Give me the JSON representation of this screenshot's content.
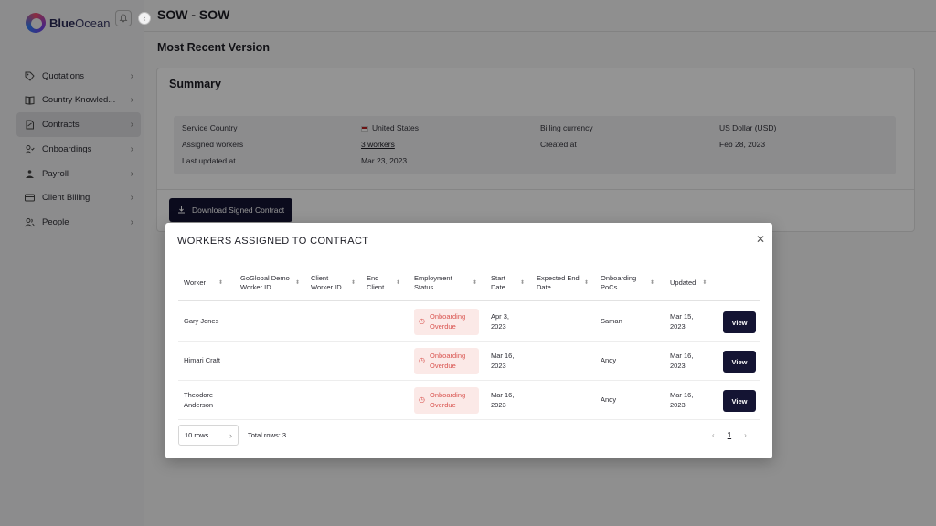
{
  "sidebar": {
    "logo": {
      "bold": "Blue",
      "rest": "Ocean"
    },
    "items": [
      {
        "label": "Quotations",
        "icon": "tag-icon"
      },
      {
        "label": "Country Knowled...",
        "icon": "book-icon"
      },
      {
        "label": "Contracts",
        "icon": "contract-icon",
        "active": true
      },
      {
        "label": "Onboardings",
        "icon": "user-check-icon"
      },
      {
        "label": "Payroll",
        "icon": "payroll-icon"
      },
      {
        "label": "Client Billing",
        "icon": "card-icon"
      },
      {
        "label": "People",
        "icon": "people-icon"
      }
    ]
  },
  "page": {
    "title": "SOW - SOW",
    "section_title": "Most Recent Version"
  },
  "summary": {
    "title": "Summary",
    "service_country_label": "Service Country",
    "service_country_value": "United States",
    "assigned_workers_label": "Assigned workers",
    "assigned_workers_value": "3 workers",
    "last_updated_label": "Last updated at",
    "last_updated_value": "Mar 23, 2023",
    "billing_currency_label": "Billing currency",
    "billing_currency_value": "US Dollar (USD)",
    "created_at_label": "Created at",
    "created_at_value": "Feb 28, 2023",
    "download_label": "Download Signed Contract"
  },
  "modal": {
    "title": "WORKERS ASSIGNED TO CONTRACT",
    "columns": [
      "Worker",
      "GoGlobal Demo Worker ID",
      "Client Worker ID",
      "End Client",
      "Employment Status",
      "Start Date",
      "Expected End Date",
      "Onboarding PoCs",
      "Updated"
    ],
    "rows": [
      {
        "worker": "Gary Jones",
        "status": "Onboarding Overdue",
        "start": "Apr 3, 2023",
        "poc": "Saman",
        "updated": "Mar 15, 2023",
        "action": "View"
      },
      {
        "worker": "Himari Craft",
        "status": "Onboarding Overdue",
        "start": "Mar 16, 2023",
        "poc": "Andy",
        "updated": "Mar 16, 2023",
        "action": "View"
      },
      {
        "worker": "Theodore Anderson",
        "status": "Onboarding Overdue",
        "start": "Mar 16, 2023",
        "poc": "Andy",
        "updated": "Mar 16, 2023",
        "action": "View"
      }
    ],
    "rows_per_page": "10 rows",
    "total_rows": "Total rows: 3",
    "current_page": "1"
  },
  "colors": {
    "primary_dark": "#141433",
    "status_overdue_text": "#d9534f",
    "status_overdue_bg": "#fbe9e7"
  }
}
